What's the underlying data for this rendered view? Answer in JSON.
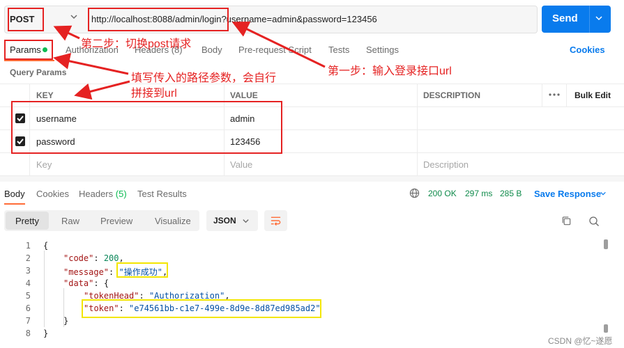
{
  "request": {
    "method": "POST",
    "url": "http://localhost:8088/admin/login?username=admin&password=123456",
    "send_label": "Send"
  },
  "request_tabs": [
    {
      "label": "Params",
      "active": true,
      "indicator_color": "#0cbb52"
    },
    {
      "label": "Authorization"
    },
    {
      "label": "Headers (8)"
    },
    {
      "label": "Body"
    },
    {
      "label": "Pre-request Script"
    },
    {
      "label": "Tests"
    },
    {
      "label": "Settings"
    }
  ],
  "cookies_link": "Cookies",
  "query_params": {
    "title": "Query Params",
    "columns": [
      "KEY",
      "VALUE",
      "DESCRIPTION"
    ],
    "bulk_edit": "Bulk Edit",
    "rows": [
      {
        "checked": true,
        "key": "username",
        "value": "admin",
        "description": ""
      },
      {
        "checked": true,
        "key": "password",
        "value": "123456",
        "description": ""
      }
    ],
    "placeholder": {
      "key": "Key",
      "value": "Value",
      "description": "Description"
    }
  },
  "response_tabs": [
    {
      "label": "Body",
      "active": true
    },
    {
      "label": "Cookies"
    },
    {
      "label": "Headers",
      "count": "(5)"
    },
    {
      "label": "Test Results"
    }
  ],
  "response_status": {
    "status": "200 OK",
    "time": "297 ms",
    "size": "285 B"
  },
  "save_response": "Save Response",
  "format_tabs": [
    "Pretty",
    "Raw",
    "Preview",
    "Visualize"
  ],
  "format_select": "JSON",
  "code_lines": [
    {
      "n": "1",
      "text": "{"
    },
    {
      "n": "2",
      "key": "\"code\"",
      "num": "200"
    },
    {
      "n": "3",
      "key": "\"message\"",
      "str": "\"操作成功\""
    },
    {
      "n": "4",
      "key": "\"data\"",
      "brace": "{"
    },
    {
      "n": "5",
      "key": "\"tokenHead\"",
      "str": "\"Authorization\""
    },
    {
      "n": "6",
      "key": "\"token\"",
      "str": "\"e74561bb-c1e7-499e-8d9e-8d87ed985ad2\""
    },
    {
      "n": "7",
      "text": "}"
    },
    {
      "n": "8",
      "text": "}"
    }
  ],
  "annotations": {
    "step2": "第二步：切换post请求",
    "step1": "第一步：输入登录接口url",
    "params_line1": "填写传入的路径参数，会自行",
    "params_line2": "拼接到url"
  },
  "watermark": "CSDN @忆~遂愿",
  "colors": {
    "accent": "#097bed",
    "tab_active": "#ff6c37",
    "annotation": "#e52222",
    "highlight": "#f3e600",
    "success": "#0e8a4a"
  },
  "icons": [
    "chevron-down-icon",
    "more-horizontal-icon",
    "globe-icon",
    "wrap-lines-icon",
    "copy-icon",
    "search-icon",
    "checkbox-checked-icon"
  ]
}
